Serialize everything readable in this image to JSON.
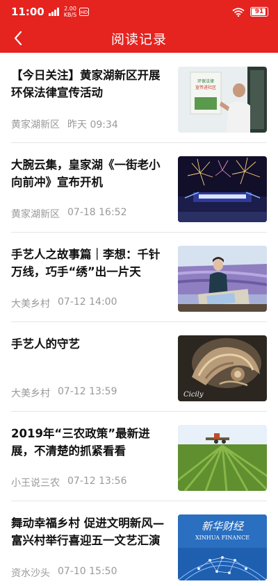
{
  "status_bar": {
    "time": "11:00",
    "speed_value": "2.00",
    "speed_unit": "KB/S",
    "battery": "91"
  },
  "header": {
    "title": "阅读记录"
  },
  "articles": [
    {
      "title": "【今日关注】黄家湖新区开展环保法律宣传活动",
      "source": "黄家湖新区",
      "time": "昨天 09:34"
    },
    {
      "title": "大腕云集，皇家湖《一街老小向前冲》宣布开机",
      "source": "黄家湖新区",
      "time": "07-18 16:52"
    },
    {
      "title": "手艺人之故事篇｜李想：千针万线，巧手“绣”出一片天",
      "source": "大美乡村",
      "time": "07-12 14:00"
    },
    {
      "title": "手艺人的守艺",
      "source": "大美乡村",
      "time": "07-12 13:59"
    },
    {
      "title": "2019年“三农政策”最新进展，不清楚的抓紧看看",
      "source": "小王说三农",
      "time": "07-12 13:56"
    },
    {
      "title": "舞动幸福乡村 促进文明新风—富兴村举行喜迎五一文艺汇演",
      "source": "资水沙头",
      "time": "07-10 15:50"
    }
  ],
  "thumb_texts": {
    "poster_line1": "环保法律",
    "poster_line2": "宣传进社区",
    "watermark": "Cicily",
    "xinhua_cn": "新华财经",
    "xinhua_en": "XINHUA FINANCE"
  },
  "colors": {
    "brand": "#e5231f",
    "meta": "#999999"
  }
}
